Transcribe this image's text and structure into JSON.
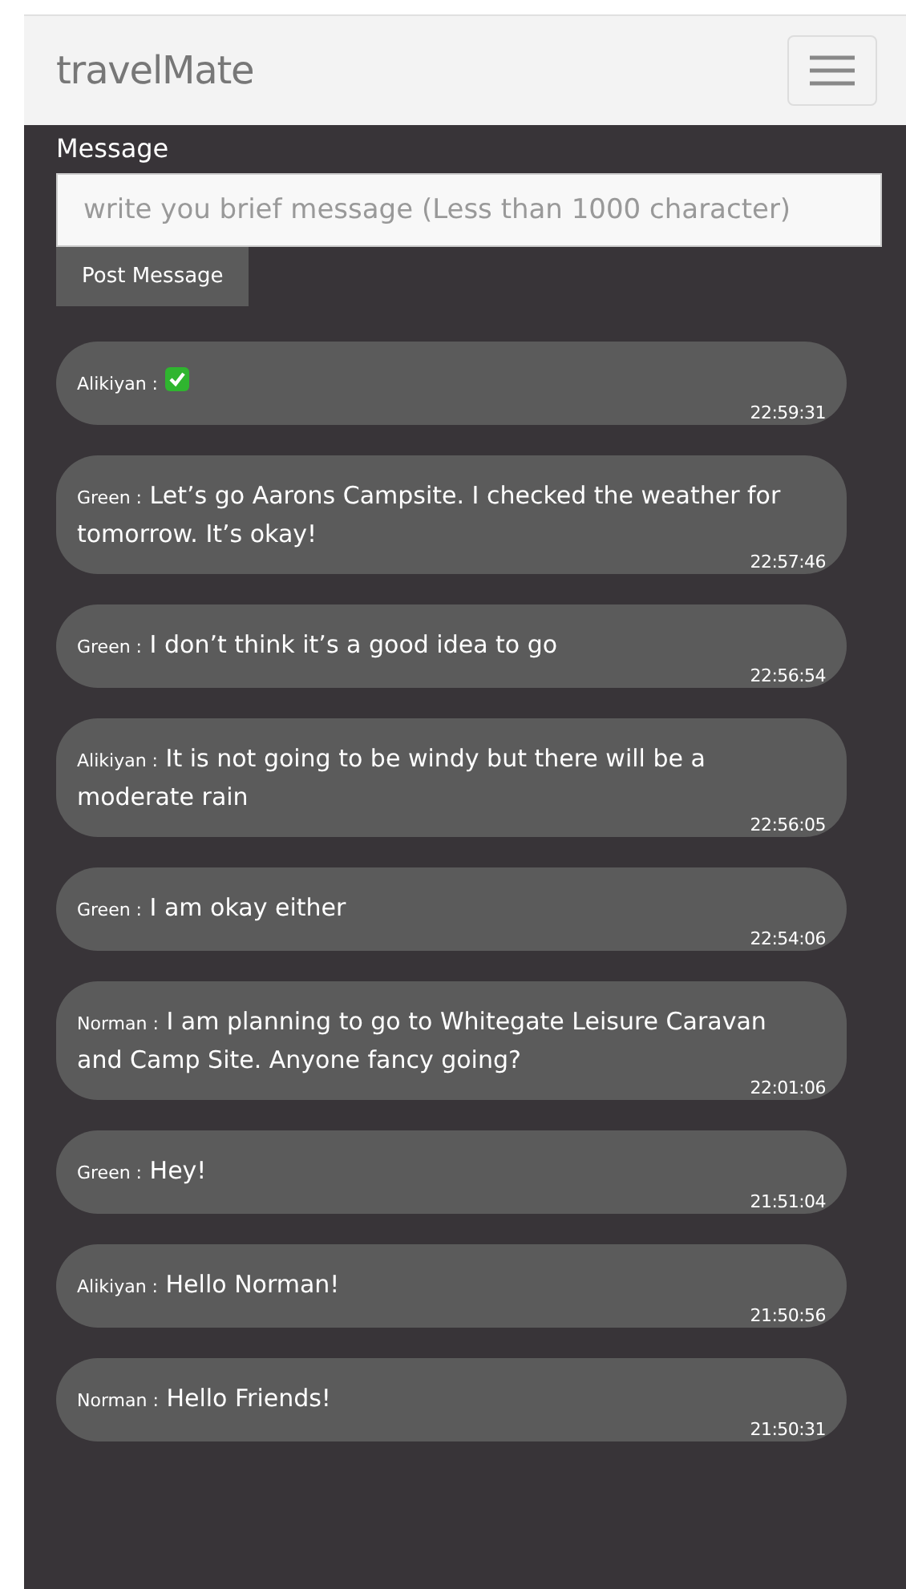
{
  "navbar": {
    "brand": "travelMate"
  },
  "form": {
    "label": "Message",
    "placeholder": "write you brief message (Less than 1000 character)",
    "button": "Post Message"
  },
  "messages": [
    {
      "kind": "check",
      "sender": "Alikiyan :",
      "time": "22:59:31"
    },
    {
      "kind": "text",
      "sender": "Green :",
      "text": "Let’s go Aarons Campsite. I checked the weather for tomorrow. It’s okay!",
      "time": "22:57:46"
    },
    {
      "kind": "text",
      "sender": "Green :",
      "text": "I don’t think it’s a good idea to go",
      "time": "22:56:54"
    },
    {
      "kind": "text",
      "sender": "Alikiyan :",
      "text": "It is not going to be windy but there will be a moderate rain",
      "time": "22:56:05"
    },
    {
      "kind": "text",
      "sender": "Green :",
      "text": "I am okay either",
      "time": "22:54:06"
    },
    {
      "kind": "text",
      "sender": "Norman :",
      "text": "I am planning to go to Whitegate Leisure Caravan and Camp Site. Anyone fancy going?",
      "time": "22:01:06"
    },
    {
      "kind": "text",
      "sender": "Green :",
      "text": "Hey!",
      "time": "21:51:04"
    },
    {
      "kind": "text",
      "sender": "Alikiyan :",
      "text": "Hello Norman!",
      "time": "21:50:56"
    },
    {
      "kind": "text",
      "sender": "Norman :",
      "text": "Hello Friends!",
      "time": "21:50:31"
    }
  ]
}
